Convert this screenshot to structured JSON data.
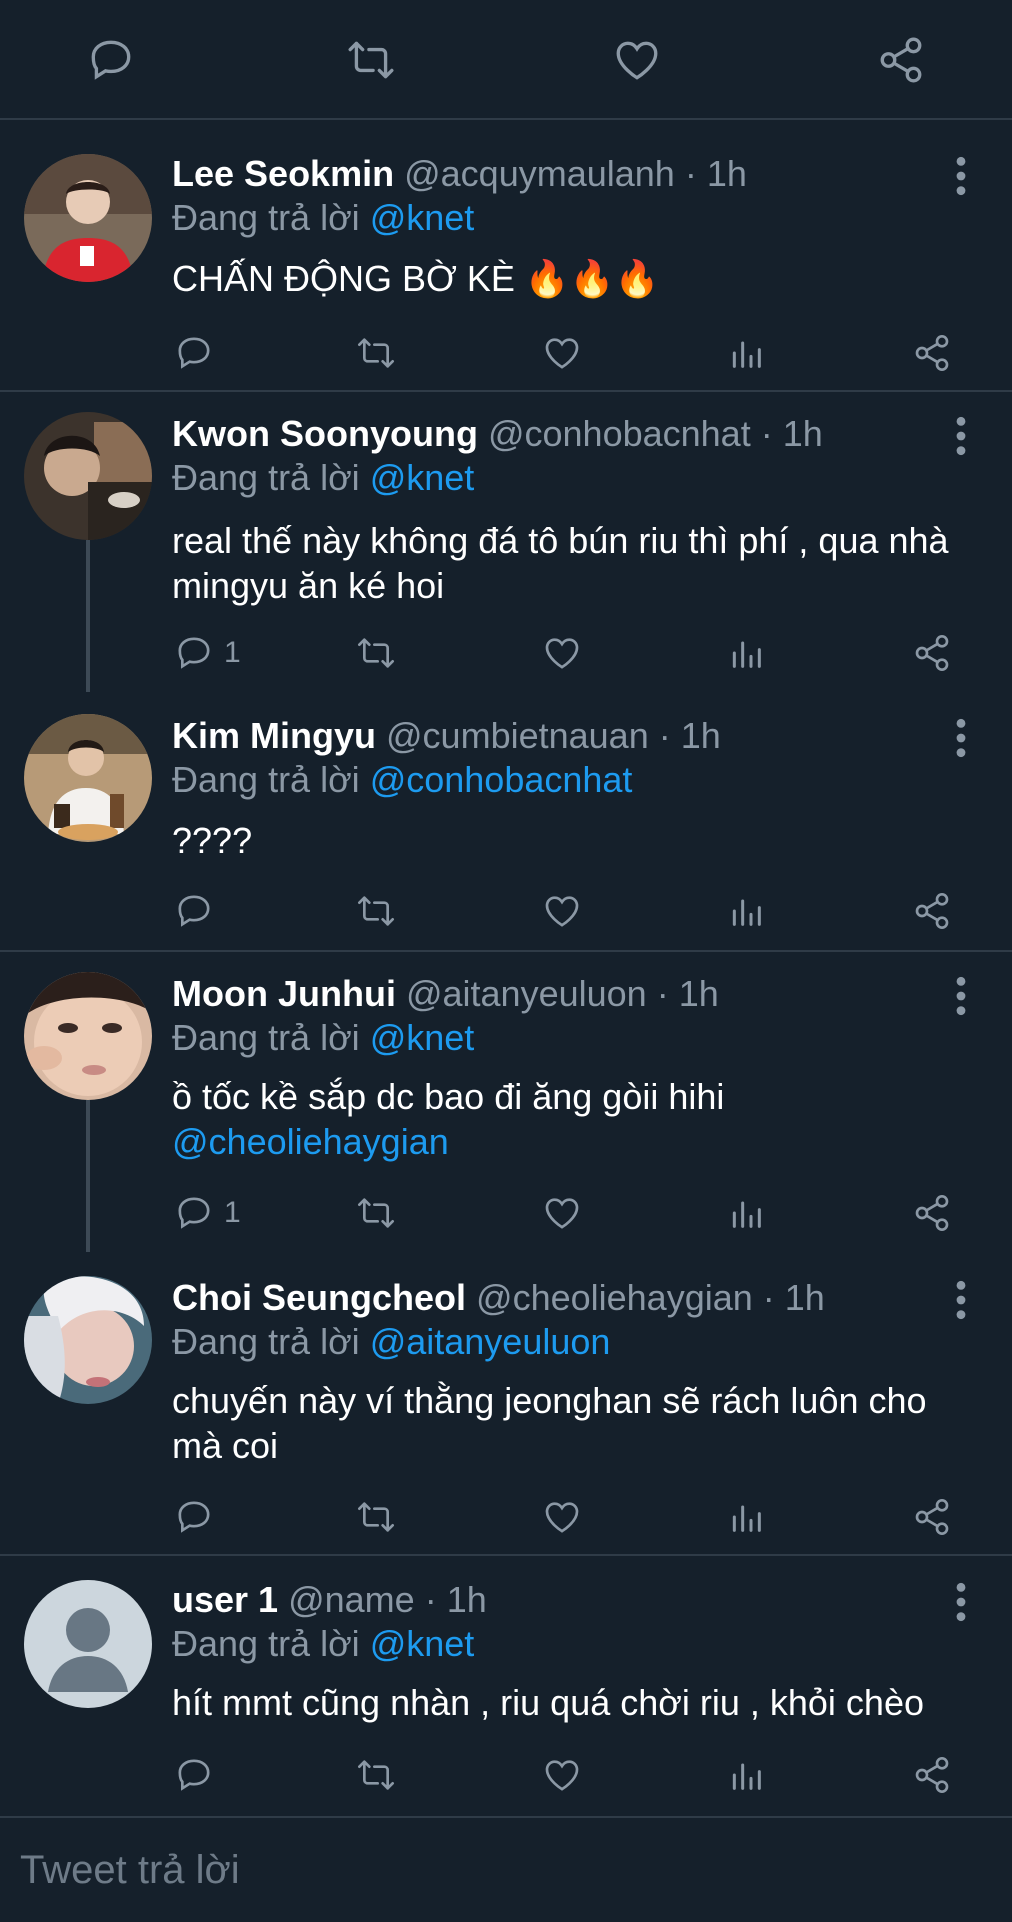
{
  "top_actions": [
    {
      "icon": "reply-icon"
    },
    {
      "icon": "retweet-icon"
    },
    {
      "icon": "like-icon"
    },
    {
      "icon": "share-icon"
    }
  ],
  "tweets": [
    {
      "name": "Lee Seokmin",
      "handle": "@acquymaulanh",
      "dot": " · ",
      "time": "1h",
      "replying_label": "Đang trả lời ",
      "replying_to": "@knet",
      "text": "CHẤN ĐỘNG BỜ KÈ 🔥🔥🔥",
      "reply_count": ""
    },
    {
      "name": "Kwon Soonyoung",
      "handle": "@conhobacnhat",
      "dot": " · ",
      "time": "1h",
      "replying_label": "Đang trả lời ",
      "replying_to": "@knet",
      "text_line1": "real thế này không đá tô bún riu thì phí , qua nhà",
      "text_line2": "mingyu ăn ké hoi",
      "reply_count": "1"
    },
    {
      "name": "Kim Mingyu",
      "handle": "@cumbietnauan",
      "dot": " · ",
      "time": "1h",
      "replying_label": "Đang trả lời ",
      "replying_to": "@conhobacnhat",
      "text": "????",
      "reply_count": ""
    },
    {
      "name": "Moon Junhui",
      "handle": "@aitanyeuluon",
      "dot": " · ",
      "time": "1h",
      "replying_label": "Đang trả lời ",
      "replying_to": "@knet",
      "text_line1": "ồ tốc kề sắp dc bao đi ăng gòii hihi",
      "text_mention": "@cheoliehaygian",
      "reply_count": "1"
    },
    {
      "name": "Choi Seungcheol",
      "handle": "@cheoliehaygian",
      "dot": " · ",
      "time": "1h",
      "replying_label": "Đang trả lời ",
      "replying_to": "@aitanyeuluon",
      "text_line1": "chuyến này ví thằng jeonghan sẽ rách luôn cho",
      "text_line2": "mà coi",
      "reply_count": ""
    },
    {
      "name": "user 1",
      "handle": "@name",
      "dot": " · ",
      "time": "1h",
      "replying_label": "Đang trả lời ",
      "replying_to": "@knet",
      "text": "hít mmt cũng nhàn , riu quá chời riu , khỏi chèo",
      "reply_count": ""
    }
  ],
  "reply_bar": {
    "placeholder": "Tweet trả lời"
  },
  "colors": {
    "background": "#15202b",
    "accent": "#1d9bf0",
    "muted": "#8b98a5",
    "separator": "#2f3b47"
  }
}
